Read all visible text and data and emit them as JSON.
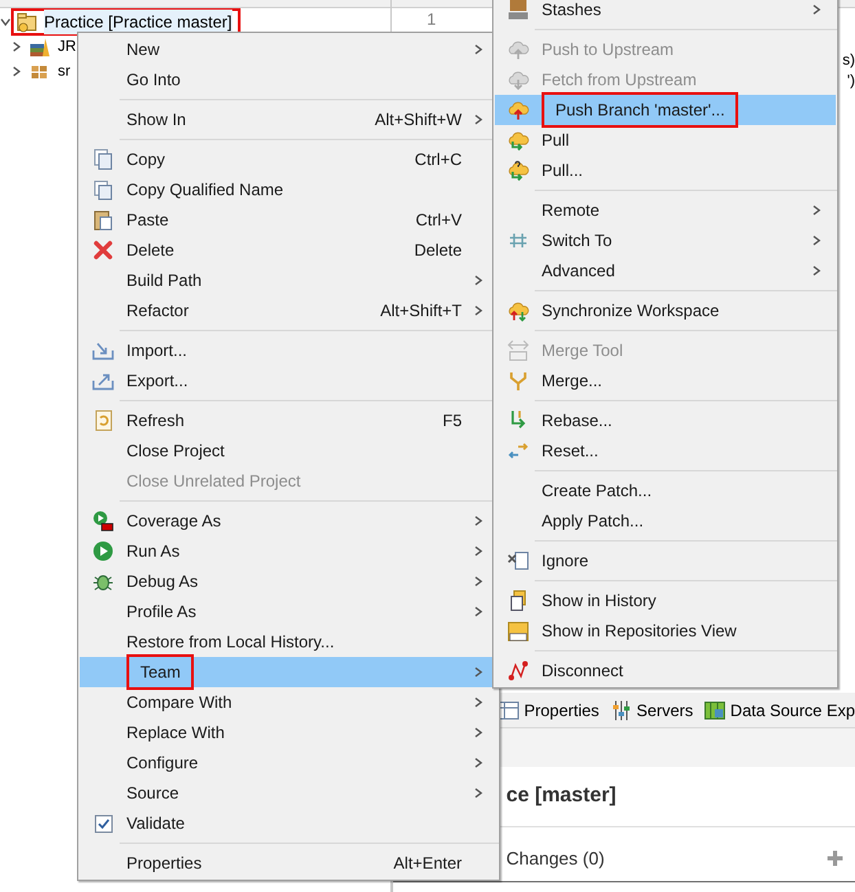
{
  "project_tree": {
    "root": {
      "label": "Practice [Practice master]",
      "expanded": true,
      "highlighted": true,
      "children": [
        {
          "label": "JR",
          "expanded": false
        },
        {
          "label": "sr",
          "expanded": false
        }
      ]
    }
  },
  "editor": {
    "line_numbers": [
      "1"
    ],
    "code_fragments": [
      "s)",
      "')"
    ]
  },
  "bottom_panel": {
    "tabs": [
      {
        "label": "Properties"
      },
      {
        "label": "Servers"
      },
      {
        "label": "Data Source Exp"
      }
    ],
    "title": "ce [master]",
    "section": "Changes (0)"
  },
  "context_menu": {
    "items": [
      {
        "kind": "item",
        "label": "New",
        "submenu": true,
        "selected": false,
        "disabled": false
      },
      {
        "kind": "item",
        "label": "Go Into",
        "selected": false,
        "disabled": false
      },
      {
        "kind": "separator"
      },
      {
        "kind": "item",
        "label": "Show In",
        "shortcut": "Alt+Shift+W",
        "submenu": true,
        "selected": false,
        "disabled": false
      },
      {
        "kind": "separator"
      },
      {
        "kind": "item",
        "label": "Copy",
        "shortcut": "Ctrl+C",
        "selected": false,
        "disabled": false
      },
      {
        "kind": "item",
        "label": "Copy Qualified Name",
        "selected": false,
        "disabled": false
      },
      {
        "kind": "item",
        "label": "Paste",
        "shortcut": "Ctrl+V",
        "selected": false,
        "disabled": false
      },
      {
        "kind": "item",
        "label": "Delete",
        "shortcut": "Delete",
        "selected": false,
        "disabled": false
      },
      {
        "kind": "item",
        "label": "Build Path",
        "submenu": true,
        "selected": false,
        "disabled": false
      },
      {
        "kind": "item",
        "label": "Refactor",
        "shortcut": "Alt+Shift+T",
        "submenu": true,
        "selected": false,
        "disabled": false
      },
      {
        "kind": "separator"
      },
      {
        "kind": "item",
        "label": "Import...",
        "selected": false,
        "disabled": false
      },
      {
        "kind": "item",
        "label": "Export...",
        "selected": false,
        "disabled": false
      },
      {
        "kind": "separator"
      },
      {
        "kind": "item",
        "label": "Refresh",
        "shortcut": "F5",
        "selected": false,
        "disabled": false
      },
      {
        "kind": "item",
        "label": "Close Project",
        "selected": false,
        "disabled": false
      },
      {
        "kind": "item",
        "label": "Close Unrelated Project",
        "selected": false,
        "disabled": true
      },
      {
        "kind": "separator"
      },
      {
        "kind": "item",
        "label": "Coverage As",
        "submenu": true,
        "selected": false,
        "disabled": false
      },
      {
        "kind": "item",
        "label": "Run As",
        "submenu": true,
        "selected": false,
        "disabled": false
      },
      {
        "kind": "item",
        "label": "Debug As",
        "submenu": true,
        "selected": false,
        "disabled": false
      },
      {
        "kind": "item",
        "label": "Profile As",
        "submenu": true,
        "selected": false,
        "disabled": false
      },
      {
        "kind": "item",
        "label": "Restore from Local History...",
        "selected": false,
        "disabled": false
      },
      {
        "kind": "item",
        "label": "Team",
        "submenu": true,
        "selected": true,
        "disabled": false,
        "highlighted": true
      },
      {
        "kind": "item",
        "label": "Compare With",
        "submenu": true,
        "selected": false,
        "disabled": false
      },
      {
        "kind": "item",
        "label": "Replace With",
        "submenu": true,
        "selected": false,
        "disabled": false
      },
      {
        "kind": "item",
        "label": "Configure",
        "submenu": true,
        "selected": false,
        "disabled": false
      },
      {
        "kind": "item",
        "label": "Source",
        "submenu": true,
        "selected": false,
        "disabled": false
      },
      {
        "kind": "checkbox",
        "label": "Validate",
        "checked": true,
        "selected": false,
        "disabled": false
      },
      {
        "kind": "separator"
      },
      {
        "kind": "item",
        "label": "Properties",
        "shortcut": "Alt+Enter",
        "selected": false,
        "disabled": false
      }
    ]
  },
  "team_submenu": {
    "items": [
      {
        "kind": "item",
        "label": "Stashes",
        "submenu": true,
        "selected": false,
        "disabled": false
      },
      {
        "kind": "separator"
      },
      {
        "kind": "item",
        "label": "Push to Upstream",
        "selected": false,
        "disabled": true
      },
      {
        "kind": "item",
        "label": "Fetch from Upstream",
        "selected": false,
        "disabled": true
      },
      {
        "kind": "item",
        "label": "Push Branch 'master'...",
        "selected": true,
        "disabled": false,
        "highlighted": true
      },
      {
        "kind": "item",
        "label": "Pull",
        "selected": false,
        "disabled": false
      },
      {
        "kind": "item",
        "label": "Pull...",
        "selected": false,
        "disabled": false
      },
      {
        "kind": "separator"
      },
      {
        "kind": "item",
        "label": "Remote",
        "submenu": true,
        "selected": false,
        "disabled": false
      },
      {
        "kind": "item",
        "label": "Switch To",
        "submenu": true,
        "selected": false,
        "disabled": false
      },
      {
        "kind": "item",
        "label": "Advanced",
        "submenu": true,
        "selected": false,
        "disabled": false
      },
      {
        "kind": "separator"
      },
      {
        "kind": "item",
        "label": "Synchronize Workspace",
        "selected": false,
        "disabled": false
      },
      {
        "kind": "separator"
      },
      {
        "kind": "item",
        "label": "Merge Tool",
        "selected": false,
        "disabled": true
      },
      {
        "kind": "item",
        "label": "Merge...",
        "selected": false,
        "disabled": false
      },
      {
        "kind": "separator"
      },
      {
        "kind": "item",
        "label": "Rebase...",
        "selected": false,
        "disabled": false
      },
      {
        "kind": "item",
        "label": "Reset...",
        "selected": false,
        "disabled": false
      },
      {
        "kind": "separator"
      },
      {
        "kind": "item",
        "label": "Create Patch...",
        "selected": false,
        "disabled": false
      },
      {
        "kind": "item",
        "label": "Apply Patch...",
        "selected": false,
        "disabled": false
      },
      {
        "kind": "separator"
      },
      {
        "kind": "item",
        "label": "Ignore",
        "selected": false,
        "disabled": false
      },
      {
        "kind": "separator"
      },
      {
        "kind": "item",
        "label": "Show in History",
        "selected": false,
        "disabled": false
      },
      {
        "kind": "item",
        "label": "Show in Repositories View",
        "selected": false,
        "disabled": false
      },
      {
        "kind": "separator"
      },
      {
        "kind": "item",
        "label": "Disconnect",
        "selected": false,
        "disabled": false
      }
    ]
  }
}
